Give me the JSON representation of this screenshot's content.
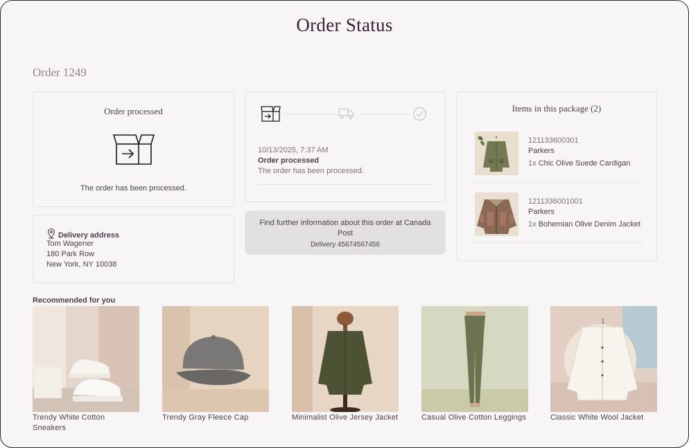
{
  "page": {
    "title": "Order Status"
  },
  "order": {
    "number": "Order 1249"
  },
  "processed_card": {
    "title": "Order processed",
    "message": "The order has been processed."
  },
  "timeline": {
    "steps": [
      {
        "icon": "box-processed-icon",
        "active": true
      },
      {
        "icon": "delivery-truck-icon",
        "active": false
      },
      {
        "icon": "check-circle-icon",
        "active": false
      }
    ],
    "event": {
      "date": "10/13/2025, 7:37 AM",
      "status": "Order processed",
      "description": "The order has been processed."
    }
  },
  "address": {
    "title": "Delivery address",
    "name": "Tom Wagener",
    "street": "180 Park Row",
    "city": "New York, NY 10038"
  },
  "info_link": {
    "text": "Find further information about this order at Canada Post",
    "delivery": "Delivery 45674567456"
  },
  "package": {
    "title": "Items in this package (2)",
    "items": [
      {
        "sku": "121133600301",
        "brand": "Parkers",
        "qty": "1x",
        "name": "Chic Olive Suede Cardigan"
      },
      {
        "sku": "1211336001001",
        "brand": "Parkers",
        "qty": "1x",
        "name": "Bohemian Olive Denim Jacket"
      }
    ]
  },
  "recommendations": {
    "title": "Recommended for you",
    "items": [
      {
        "name": "Trendy White Cotton Sneakers"
      },
      {
        "name": "Trendy Gray Fleece Cap"
      },
      {
        "name": "Minimalist Olive Jersey Jacket"
      },
      {
        "name": "Casual Olive Cotton Leggings"
      },
      {
        "name": "Classic White Wool Jacket"
      }
    ]
  },
  "colors": {
    "title": "#3a1f35",
    "background": "#f8f5f6",
    "card_border": "#e3dfe2",
    "button_bg": "#e2e0e2",
    "text": "#4a3f48",
    "muted": "#7a707a"
  }
}
